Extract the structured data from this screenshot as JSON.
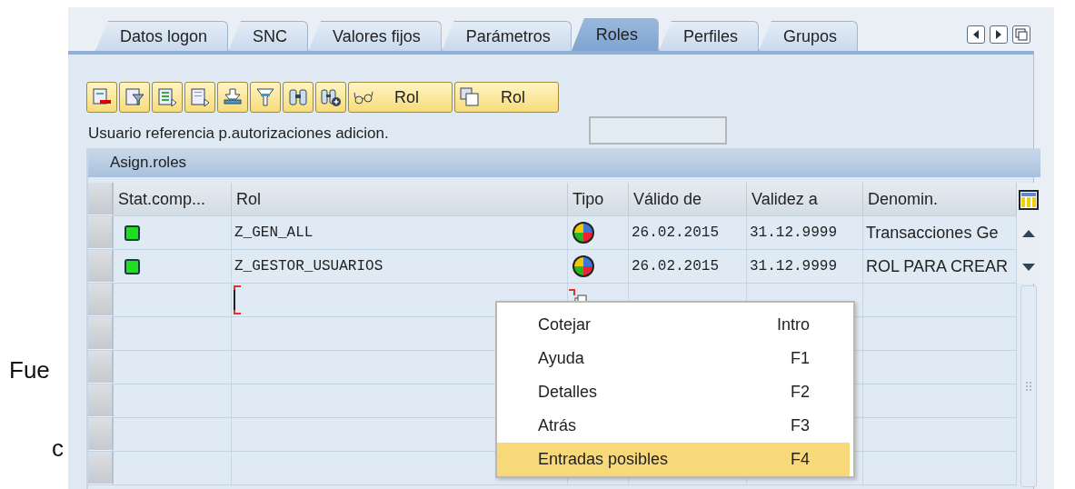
{
  "background_text": [
    "Fue",
    "c"
  ],
  "tabs": [
    {
      "label": "Datos logon",
      "selected": false
    },
    {
      "label": "SNC",
      "selected": false
    },
    {
      "label": "Valores fijos",
      "selected": false
    },
    {
      "label": "Parámetros",
      "selected": false
    },
    {
      "label": "Roles",
      "selected": true
    },
    {
      "label": "Perfiles",
      "selected": false
    },
    {
      "label": "Grupos",
      "selected": false
    }
  ],
  "toolbar": [
    {
      "kind": "icon"
    },
    {
      "kind": "icon"
    },
    {
      "kind": "icon"
    },
    {
      "kind": "icon"
    },
    {
      "kind": "icon"
    },
    {
      "kind": "icon"
    },
    {
      "kind": "icon"
    },
    {
      "kind": "icon"
    },
    {
      "kind": "text",
      "label": "Rol"
    },
    {
      "kind": "text",
      "label": "Rol"
    }
  ],
  "reference_user": {
    "label": "Usuario referencia p.autorizaciones adicion."
  },
  "table": {
    "title": "Asign.roles",
    "columns": [
      "Stat.comp...",
      "Rol",
      "Tipo",
      "Válido de",
      "Validez a",
      "Denomin."
    ],
    "rows": [
      {
        "color": "#22dd22",
        "role": "Z_GEN_ALL",
        "valid_from": "26.02.2015",
        "valid_to": "31.12.9999",
        "description": "Transacciones Ge"
      },
      {
        "color": "#22dd22",
        "role": "Z_GESTOR_USUARIOS",
        "valid_from": "26.02.2015",
        "valid_to": "31.12.9999",
        "description": "ROL PARA CREAR"
      }
    ],
    "input_row_focused": true
  },
  "context_menu": [
    {
      "label": "Cotejar",
      "shortcut": "Intro",
      "selected": false
    },
    {
      "label": "Ayuda",
      "shortcut": "F1",
      "selected": false
    },
    {
      "label": "Detalles",
      "shortcut": "F2",
      "selected": false
    },
    {
      "label": "Atrás",
      "shortcut": "F3",
      "selected": false
    },
    {
      "label": "Entradas posibles",
      "shortcut": "F4",
      "selected": true
    }
  ]
}
